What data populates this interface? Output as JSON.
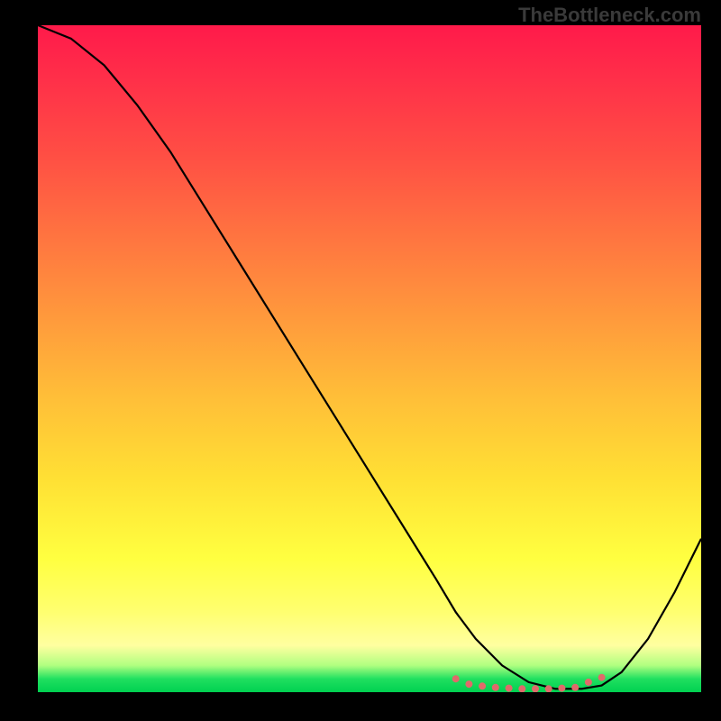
{
  "watermark": "TheBottleneck.com",
  "chart_data": {
    "type": "line",
    "title": "",
    "xlabel": "",
    "ylabel": "",
    "xlim": [
      0,
      100
    ],
    "ylim": [
      0,
      100
    ],
    "series": [
      {
        "name": "curve",
        "x": [
          0,
          5,
          10,
          15,
          20,
          25,
          30,
          35,
          40,
          45,
          50,
          55,
          60,
          63,
          66,
          70,
          74,
          78,
          82,
          85,
          88,
          92,
          96,
          100
        ],
        "y": [
          100,
          98,
          94,
          88,
          81,
          73,
          65,
          57,
          49,
          41,
          33,
          25,
          17,
          12,
          8,
          4,
          1.5,
          0.5,
          0.5,
          1,
          3,
          8,
          15,
          23
        ]
      }
    ],
    "markers": {
      "name": "dots",
      "color": "#e06a6a",
      "x": [
        63,
        65,
        67,
        69,
        71,
        73,
        75,
        77,
        79,
        81,
        83,
        85
      ],
      "y": [
        2.0,
        1.2,
        0.9,
        0.7,
        0.6,
        0.5,
        0.5,
        0.5,
        0.6,
        0.7,
        1.5,
        2.2
      ]
    },
    "gradient_stops": [
      {
        "pos": 0,
        "color": "#ff1a4a"
      },
      {
        "pos": 20,
        "color": "#ff5044"
      },
      {
        "pos": 44,
        "color": "#ff9a3c"
      },
      {
        "pos": 68,
        "color": "#ffe034"
      },
      {
        "pos": 88,
        "color": "#ffff70"
      },
      {
        "pos": 96,
        "color": "#b0ff80"
      },
      {
        "pos": 100,
        "color": "#00d050"
      }
    ]
  }
}
